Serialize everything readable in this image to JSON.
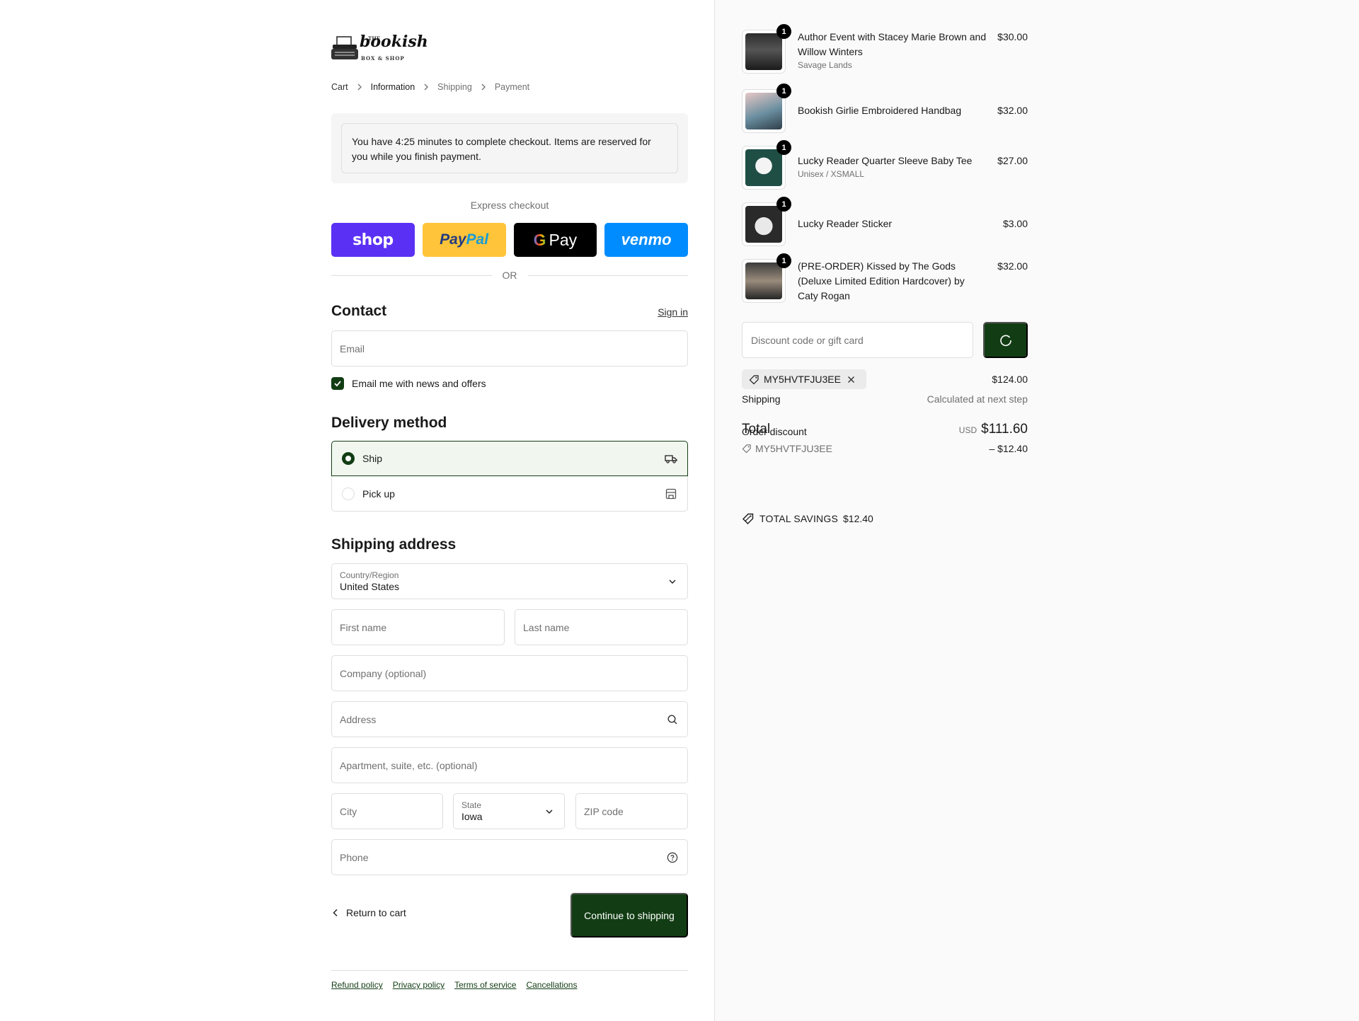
{
  "logo": {
    "the": "THE",
    "name": "bookish",
    "sub": "BOX & SHOP"
  },
  "breadcrumb": {
    "cart": "Cart",
    "information": "Information",
    "shipping": "Shipping",
    "payment": "Payment"
  },
  "notice": "You have 4:25 minutes to complete checkout. Items are reserved for you while you finish payment.",
  "express": {
    "title": "Express checkout",
    "shop": "shop",
    "paypal_1": "Pay",
    "paypal_2": "Pal",
    "gpay_g": "G",
    "gpay_pay": "Pay",
    "venmo": "venmo",
    "or": "OR"
  },
  "contact": {
    "title": "Contact",
    "signin": "Sign in",
    "email_placeholder": "Email",
    "newsletter_label": "Email me with news and offers",
    "newsletter_checked": true
  },
  "delivery": {
    "title": "Delivery method",
    "options": [
      {
        "label": "Ship",
        "selected": true,
        "icon": "truck-icon"
      },
      {
        "label": "Pick up",
        "selected": false,
        "icon": "store-icon"
      }
    ]
  },
  "shipping_address": {
    "title": "Shipping address",
    "country_label": "Country/Region",
    "country_value": "United States",
    "first_name": "First name",
    "last_name": "Last name",
    "company": "Company (optional)",
    "address": "Address",
    "apartment": "Apartment, suite, etc. (optional)",
    "city": "City",
    "state_label": "State",
    "state_value": "Iowa",
    "zip": "ZIP code",
    "phone": "Phone"
  },
  "nav": {
    "return": "Return to cart",
    "continue": "Continue to shipping"
  },
  "footer": {
    "refund": "Refund policy",
    "privacy": "Privacy policy",
    "terms": "Terms of service",
    "cancellations": "Cancellations"
  },
  "cart": {
    "items": [
      {
        "name": "Author Event with Stacey Marie Brown and Willow Winters",
        "variant": "Savage Lands",
        "price": "$30.00",
        "qty": "1"
      },
      {
        "name": "Bookish Girlie Embroidered Handbag",
        "variant": "",
        "price": "$32.00",
        "qty": "1"
      },
      {
        "name": "Lucky Reader Quarter Sleeve Baby Tee",
        "variant": "Unisex / XSMALL",
        "price": "$27.00",
        "qty": "1"
      },
      {
        "name": "Lucky Reader Sticker",
        "variant": "",
        "price": "$3.00",
        "qty": "1"
      },
      {
        "name": "(PRE-ORDER) Kissed by The Gods (Deluxe Limited Edition Hardcover) by Caty Rogan",
        "variant": "",
        "price": "$32.00",
        "qty": "1"
      }
    ],
    "discount_placeholder": "Discount code or gift card",
    "applied_code": "MY5HVTFJU3EE",
    "subtotal": "$124.00",
    "shipping_label": "Shipping",
    "shipping_value": "Calculated at next step",
    "total_label": "Total",
    "currency": "USD",
    "total": "$111.60",
    "order_discount_label": "Order discount",
    "discount_code": "MY5HVTFJU3EE",
    "discount_amount": "– $12.40",
    "savings_label": "TOTAL SAVINGS",
    "savings_amount": "$12.40"
  },
  "colors": {
    "accent": "#123d14",
    "shop": "#5a31f4",
    "paypal": "#ffc439",
    "venmo": "#008cff"
  }
}
